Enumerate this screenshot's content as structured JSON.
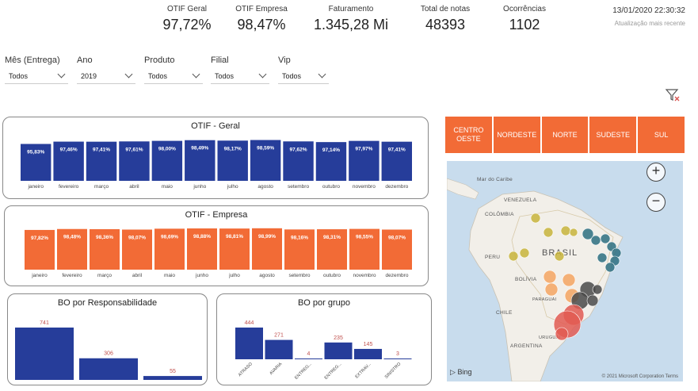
{
  "kpis": [
    {
      "label": "OTIF Geral",
      "value": "97,72%"
    },
    {
      "label": "OTIF Empresa",
      "value": "98,47%"
    },
    {
      "label": "Faturamento",
      "value": "1.345,28 Mi"
    },
    {
      "label": "Total de notas",
      "value": "48393"
    },
    {
      "label": "Ocorrências",
      "value": "1102"
    }
  ],
  "timestamp": {
    "datetime": "13/01/2020 22:30:32",
    "label": "Atualização mais recente"
  },
  "filters": [
    {
      "label": "Mês (Entrega)",
      "value": "Todos"
    },
    {
      "label": "Ano",
      "value": "2019"
    },
    {
      "label": "Produto",
      "value": "Todos"
    },
    {
      "label": "Filial",
      "value": "Todos"
    },
    {
      "label": "Vip",
      "value": "Todos"
    }
  ],
  "colors": {
    "blue": "#263d9a",
    "orange": "#f26b36",
    "map_water": "#c8dced",
    "map_land": "#f2efe9"
  },
  "chart_data": [
    {
      "type": "bar",
      "title": "OTIF - Geral",
      "categories": [
        "janeiro",
        "fevereiro",
        "março",
        "abril",
        "maio",
        "junho",
        "julho",
        "agosto",
        "setembro",
        "outubro",
        "novembro",
        "dezembro"
      ],
      "values": [
        95.83,
        97.46,
        97.41,
        97.61,
        98.0,
        98.49,
        98.17,
        98.59,
        97.62,
        97.14,
        97.97,
        97.41
      ],
      "labels": [
        "95,83%",
        "97,46%",
        "97,41%",
        "97,61%",
        "98,00%",
        "98,49%",
        "98,17%",
        "98,59%",
        "97,62%",
        "97,14%",
        "97,97%",
        "97,41%"
      ],
      "color": "#263d9a"
    },
    {
      "type": "bar",
      "title": "OTIF - Empresa",
      "categories": [
        "janeiro",
        "fevereiro",
        "março",
        "abril",
        "maio",
        "junho",
        "julho",
        "agosto",
        "setembro",
        "outubro",
        "novembro",
        "dezembro"
      ],
      "values": [
        97.82,
        98.48,
        98.36,
        98.07,
        98.69,
        98.88,
        98.81,
        98.99,
        98.16,
        98.31,
        98.55,
        98.07
      ],
      "labels": [
        "97,82%",
        "98,48%",
        "98,36%",
        "98,07%",
        "98,69%",
        "98,88%",
        "98,81%",
        "98,99%",
        "98,16%",
        "98,31%",
        "98,55%",
        "98,07%"
      ],
      "color": "#f26b36"
    },
    {
      "type": "bar",
      "title": "BO por Responsabilidade",
      "categories": [
        "",
        "",
        ""
      ],
      "values": [
        741,
        306,
        55
      ],
      "color": "#263d9a"
    },
    {
      "type": "bar",
      "title": "BO por grupo",
      "categories": [
        "ATRASO",
        "AVARIA",
        "ENTREG...",
        "ENTREG...",
        "EXTRAV...",
        "SINISTRO"
      ],
      "values": [
        444,
        271,
        4,
        235,
        145,
        3
      ],
      "color": "#263d9a"
    }
  ],
  "regions": [
    "CENTRO OESTE",
    "NORDESTE",
    "NORTE",
    "SUDESTE",
    "SUL"
  ],
  "map": {
    "labels": [
      "Mar do Caribe",
      "VENEZUELA",
      "COLÔMBIA",
      "BRASIL",
      "PERU",
      "BOLÍVIA",
      "PARAGUAI",
      "CHILE",
      "ARGENTINA",
      "URUGUAI"
    ],
    "provider": "Bing",
    "copyright": "© 2021 Microsoft Corporation Terms",
    "zoom_in": "+",
    "zoom_out": "−",
    "bubbles": [
      {
        "region": "NORTE",
        "color": "#c8b43c",
        "weight": 1
      },
      {
        "region": "NORDESTE",
        "color": "#2d6e80",
        "weight": 1
      },
      {
        "region": "CENTRO OESTE",
        "color": "#f4a462",
        "weight": 1
      },
      {
        "region": "SUDESTE",
        "color": "#4a4a4a",
        "weight": 2
      },
      {
        "region": "SUL",
        "color": "#e25a52",
        "weight": 3
      }
    ]
  }
}
